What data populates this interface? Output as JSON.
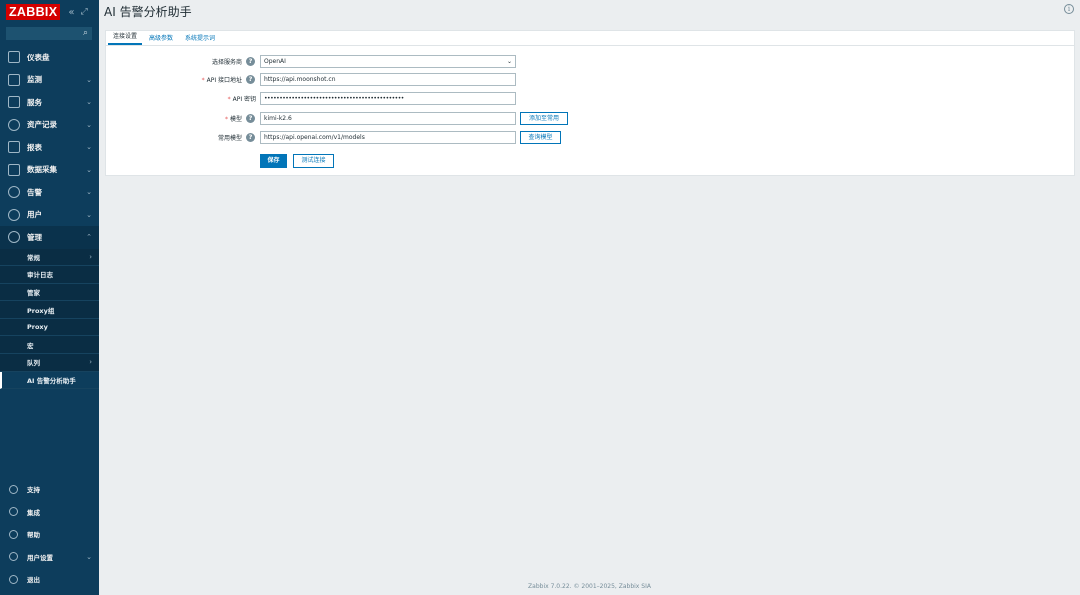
{
  "sidebar": {
    "logo": "ZABBIX",
    "collapse_icon": "«",
    "kiosk_icon": "⤢",
    "search": {
      "value": "",
      "placeholder": ""
    },
    "menu": [
      {
        "label": "仪表盘",
        "icon": "dashboard-icon",
        "arrow": ""
      },
      {
        "label": "监测",
        "icon": "monitoring-icon",
        "arrow": "⌄"
      },
      {
        "label": "服务",
        "icon": "services-icon",
        "arrow": "⌄"
      },
      {
        "label": "资产记录",
        "icon": "inventory-icon",
        "arrow": "⌄"
      },
      {
        "label": "报表",
        "icon": "reports-icon",
        "arrow": "⌄"
      },
      {
        "label": "数据采集",
        "icon": "data-collection-icon",
        "arrow": "⌄"
      },
      {
        "label": "告警",
        "icon": "alerts-icon",
        "arrow": "⌄"
      },
      {
        "label": "用户",
        "icon": "users-icon",
        "arrow": "⌄"
      },
      {
        "label": "管理",
        "icon": "administration-icon",
        "arrow": "⌃"
      }
    ],
    "submenu": [
      {
        "label": "常规",
        "arrow": "›"
      },
      {
        "label": "审计日志",
        "arrow": ""
      },
      {
        "label": "管家",
        "arrow": ""
      },
      {
        "label": "Proxy组",
        "arrow": ""
      },
      {
        "label": "Proxy",
        "arrow": ""
      },
      {
        "label": "宏",
        "arrow": ""
      },
      {
        "label": "队列",
        "arrow": "›"
      },
      {
        "label": "AI 告警分析助手",
        "arrow": ""
      }
    ],
    "bottom": [
      {
        "label": "支持",
        "icon": "support-icon",
        "arrow": ""
      },
      {
        "label": "集成",
        "icon": "integrations-icon",
        "arrow": ""
      },
      {
        "label": "帮助",
        "icon": "help-icon",
        "arrow": ""
      },
      {
        "label": "用户设置",
        "icon": "user-settings-icon",
        "arrow": "⌄"
      },
      {
        "label": "退出",
        "icon": "sign-out-icon",
        "arrow": ""
      }
    ]
  },
  "header": {
    "title": "AI 告警分析助手",
    "info_icon": "i"
  },
  "tabs": [
    "连接设置",
    "高级参数",
    "系统提示词"
  ],
  "form": {
    "provider": {
      "label": "选择服务商",
      "value": "OpenAI"
    },
    "api_url": {
      "label": "API 接口地址",
      "value": "https://api.moonshot.cn"
    },
    "api_key": {
      "label": "API 密钥",
      "value": "••••••••••••••••••••••••••••••••••••••••••••••"
    },
    "model": {
      "label": "模型",
      "value": "kimi-k2.6",
      "button": "添加至常用"
    },
    "common_models": {
      "label": "常用模型",
      "value": "https://api.openai.com/v1/models",
      "button": "查询模型"
    },
    "save_label": "保存",
    "test_label": "测试连接",
    "help_glyph": "?",
    "required_mark": "*"
  },
  "footer": "Zabbix 7.0.22. © 2001–2025, Zabbix SIA"
}
